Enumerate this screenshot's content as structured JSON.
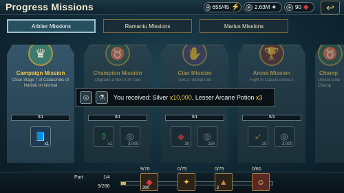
{
  "header": {
    "title": "Progress Missions",
    "energy": "655/45",
    "silver": "2.63M",
    "gems": "90"
  },
  "tabs": [
    {
      "label": "Arbiter Missions"
    },
    {
      "label": "Ramantu Missions"
    },
    {
      "label": "Marius Missions"
    }
  ],
  "cards": [
    {
      "name": "Campaign Mission",
      "desc": "Clear Stage 7 of Catacombs of Narbuk on Normal",
      "progress": "0/1",
      "rewards": [
        {
          "icon": "book-icon",
          "qty": "x1"
        }
      ]
    },
    {
      "name": "Champion Mission",
      "desc": "Upgrade a Non-XTK rare",
      "progress": "0/1",
      "rewards": [
        {
          "icon": "potion-icon",
          "qty": "x1"
        },
        {
          "icon": "silver-coins-icon",
          "qty": "3,000"
        }
      ]
    },
    {
      "name": "Clan Mission",
      "desc": "Get a Tutorial Life",
      "progress": "0/1",
      "rewards": [
        {
          "icon": "ruby-icon",
          "qty": "30"
        },
        {
          "icon": "silver-coins-icon",
          "qty": "15K"
        }
      ]
    },
    {
      "name": "Arena Mission",
      "desc": "Fight in Classic Arena 3",
      "progress": "0/3",
      "rewards": [
        {
          "icon": "arrow-icon",
          "qty": "10"
        },
        {
          "icon": "silver-coins-icon",
          "qty": "3,000"
        }
      ]
    },
    {
      "name": "Champ",
      "desc": "Unlock a Ne Champ",
      "progress": "",
      "rewards": []
    }
  ],
  "popup": {
    "prefix": "You received:",
    "item1": "Silver",
    "qty1": "x10,000",
    "sep": ",",
    "item2": "Lesser Arcane Potion",
    "qty2": "x3"
  },
  "bottom": {
    "part_label": "Part",
    "part_value": "1/4",
    "total_value": "9/286",
    "chests": [
      {
        "count": "9/76",
        "qty": "300",
        "icon": "ruby-icon"
      },
      {
        "count": "0/75",
        "qty": "",
        "icon": "amulet-icon"
      },
      {
        "count": "0/75",
        "qty": "2",
        "icon": "shard-icon"
      },
      {
        "count": "0/60",
        "qty": "",
        "icon": "champion-portrait-icon"
      }
    ]
  }
}
